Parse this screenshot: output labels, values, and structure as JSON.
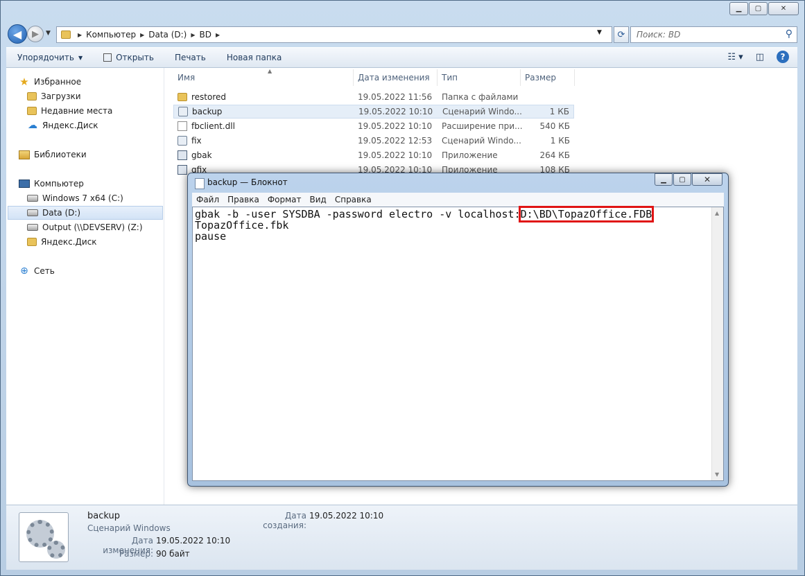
{
  "explorer": {
    "breadcrumb": [
      "Компьютер",
      "Data (D:)",
      "BD"
    ],
    "search_placeholder": "Поиск: BD",
    "toolbar": {
      "organize": "Упорядочить",
      "open": "Открыть",
      "print": "Печать",
      "new_folder": "Новая папка"
    },
    "nav": {
      "favorites": "Избранное",
      "downloads": "Загрузки",
      "recent": "Недавние места",
      "yadisk1": "Яндекс.Диск",
      "libraries": "Библиотеки",
      "computer": "Компьютер",
      "drive_c": "Windows 7 x64 (C:)",
      "drive_d": "Data (D:)",
      "drive_z": "Output (\\\\DEVSERV) (Z:)",
      "yadisk2": "Яндекс.Диск",
      "network": "Сеть"
    },
    "columns": {
      "name": "Имя",
      "date": "Дата изменения",
      "type": "Тип",
      "size": "Размер"
    },
    "files": [
      {
        "name": "restored",
        "date": "19.05.2022 11:56",
        "type": "Папка с файлами",
        "size": "",
        "icon": "folder-icon"
      },
      {
        "name": "backup",
        "date": "19.05.2022 10:10",
        "type": "Сценарий Windo...",
        "size": "1 КБ",
        "icon": "script-icon"
      },
      {
        "name": "fbclient.dll",
        "date": "19.05.2022 10:10",
        "type": "Расширение при...",
        "size": "540 КБ",
        "icon": "dll-icon"
      },
      {
        "name": "fix",
        "date": "19.05.2022 12:53",
        "type": "Сценарий Windo...",
        "size": "1 КБ",
        "icon": "script-icon"
      },
      {
        "name": "gbak",
        "date": "19.05.2022 10:10",
        "type": "Приложение",
        "size": "264 КБ",
        "icon": "exe-icon"
      },
      {
        "name": "gfix",
        "date": "19.05.2022 10:10",
        "type": "Приложение",
        "size": "108 КБ",
        "icon": "exe-icon"
      }
    ],
    "details": {
      "name": "backup",
      "type": "Сценарий Windows",
      "modified_label": "Дата изменения:",
      "modified_value": "19.05.2022 10:10",
      "size_label": "Размер:",
      "size_value": "90 байт",
      "created_label": "Дата создания:",
      "created_value": "19.05.2022 10:10"
    }
  },
  "notepad": {
    "title": "backup — Блокнот",
    "menu": [
      "Файл",
      "Правка",
      "Формат",
      "Вид",
      "Справка"
    ],
    "line1_prefix": "gbak -b -user SYSDBA -password electro -v localhost:",
    "line1_highlight": "D:\\BD\\TopazOffice.FDB",
    "line2": "TopazOffice.fbk",
    "line3": "pause"
  },
  "colors": {
    "highlight_box": "#e01414",
    "selection": "#e5eef8"
  }
}
